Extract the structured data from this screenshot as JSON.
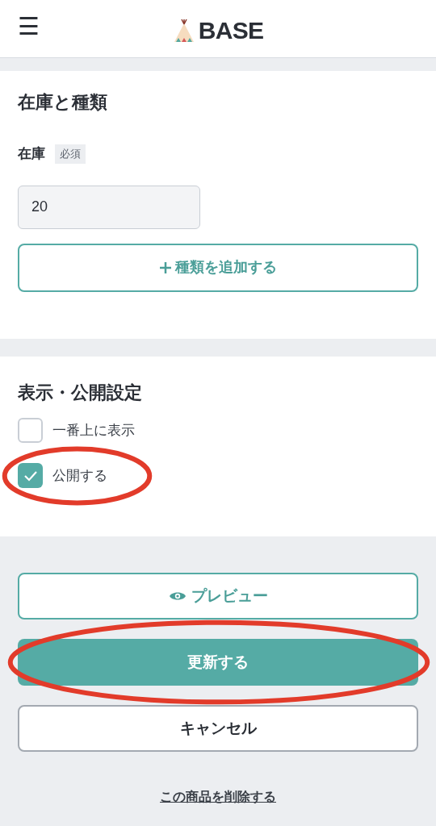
{
  "header": {
    "menu_icon": "☰",
    "logo": "BASE"
  },
  "stock_section": {
    "title": "在庫と種類",
    "field_label": "在庫",
    "required_badge": "必須",
    "stock_value": "20",
    "add_variant_button": "種類を追加する"
  },
  "visibility_section": {
    "title": "表示・公開設定",
    "options": [
      {
        "label": "一番上に表示",
        "checked": false,
        "highlighted": false
      },
      {
        "label": "公開する",
        "checked": true,
        "highlighted": true
      }
    ]
  },
  "actions": [
    {
      "kind": "outline",
      "label": "プレビュー",
      "highlighted": false
    },
    {
      "kind": "primary",
      "label": "更新する",
      "highlighted": true
    },
    {
      "kind": "secondary",
      "label": "キャンセル",
      "highlighted": false
    },
    {
      "kind": "link",
      "label": "この商品を削除する",
      "highlighted": false
    }
  ]
}
